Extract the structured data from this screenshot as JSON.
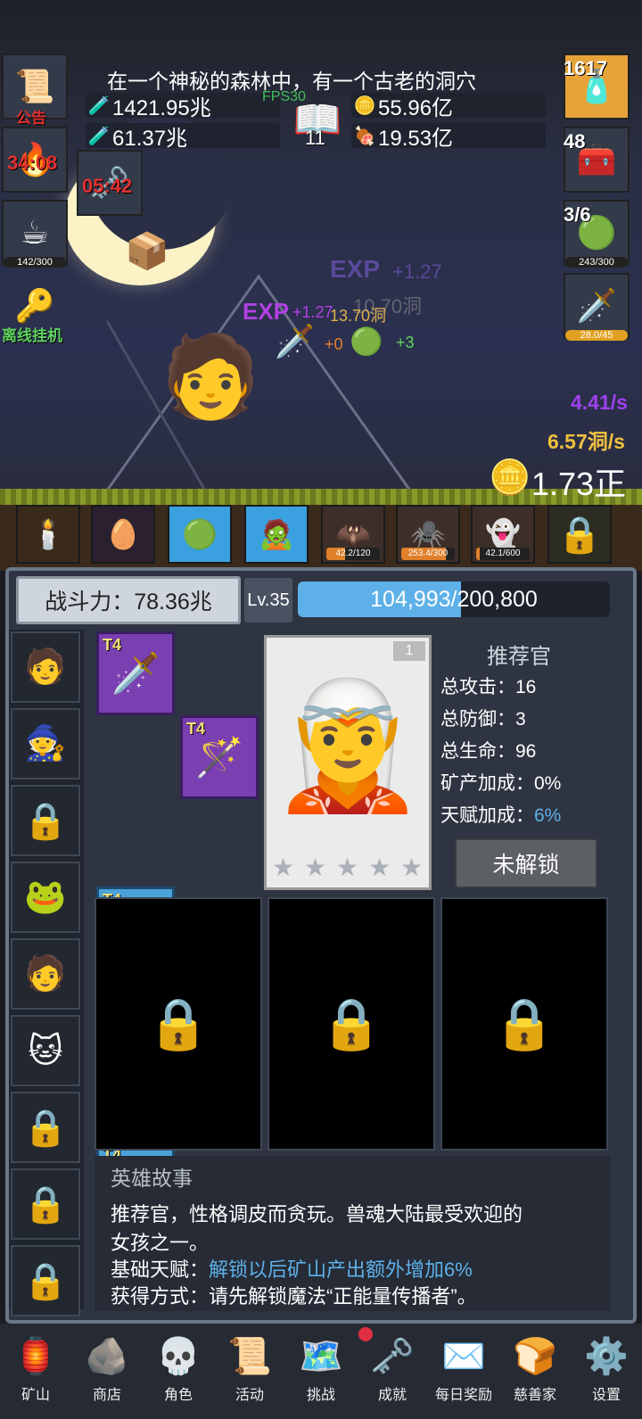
{
  "story_banner": "在一个神秘的森林中，有一个古老的洞穴",
  "fps": "FPS30",
  "resources": {
    "potion_blue": "1421.95兆",
    "potion_green": "61.37兆",
    "book_count": "11",
    "coin": "55.96亿",
    "meat": "19.53亿"
  },
  "left_buttons": {
    "notice": "公告",
    "torch_timer": "34:08",
    "key_timer": "05:42",
    "coffee_progress": "142/300",
    "offline": "离线挂机"
  },
  "right_buttons": {
    "potion_count": "1617",
    "chest_count": "48",
    "slime_count": "3/6",
    "slime_progress": "243/300",
    "sword_progress": "28.0/45"
  },
  "floating": {
    "exp1": "+1.27",
    "exp1_val": "10.70洞",
    "exp2": "+1.27",
    "exp2_val": "13.70洞",
    "plus0": "+0",
    "plus3": "+3",
    "rate1": "4.41/s",
    "rate2": "6.57洞/s",
    "gold_total": "1.73正"
  },
  "monster_slots": [
    {
      "bar": "42.2/120",
      "fill": 0.35
    },
    {
      "bar": "253.4/300",
      "fill": 0.84
    },
    {
      "bar": "42.1/600",
      "fill": 0.07
    }
  ],
  "panel": {
    "power": "战斗力：78.36兆",
    "level": "Lv.35",
    "exp_text": "104,993/200,800",
    "exp_fraction": 0.523,
    "portrait_number": "1",
    "hero_name": "推荐官",
    "stats": {
      "atk": "总攻击：16",
      "def": "总防御：3",
      "hp": "总生命：96",
      "mine": "矿产加成：0%",
      "talent_label": "天赋加成：",
      "talent_value": "6%"
    },
    "unlock_button": "未解锁",
    "equip_tier": "T4"
  },
  "story": {
    "title": "英雄故事",
    "line1": "推荐官，性格调皮而贪玩。兽魂大陆最受欢迎的",
    "line2": "女孩之一。",
    "talent_label": "基础天赋：",
    "talent_text": "解锁以后矿山产出额外增加6%",
    "obtain": "获得方式：请先解锁魔法“正能量传播者”。"
  },
  "nav": [
    "矿山",
    "商店",
    "角色",
    "活动",
    "挑战",
    "成就",
    "每日奖励",
    "慈善家",
    "设置"
  ]
}
